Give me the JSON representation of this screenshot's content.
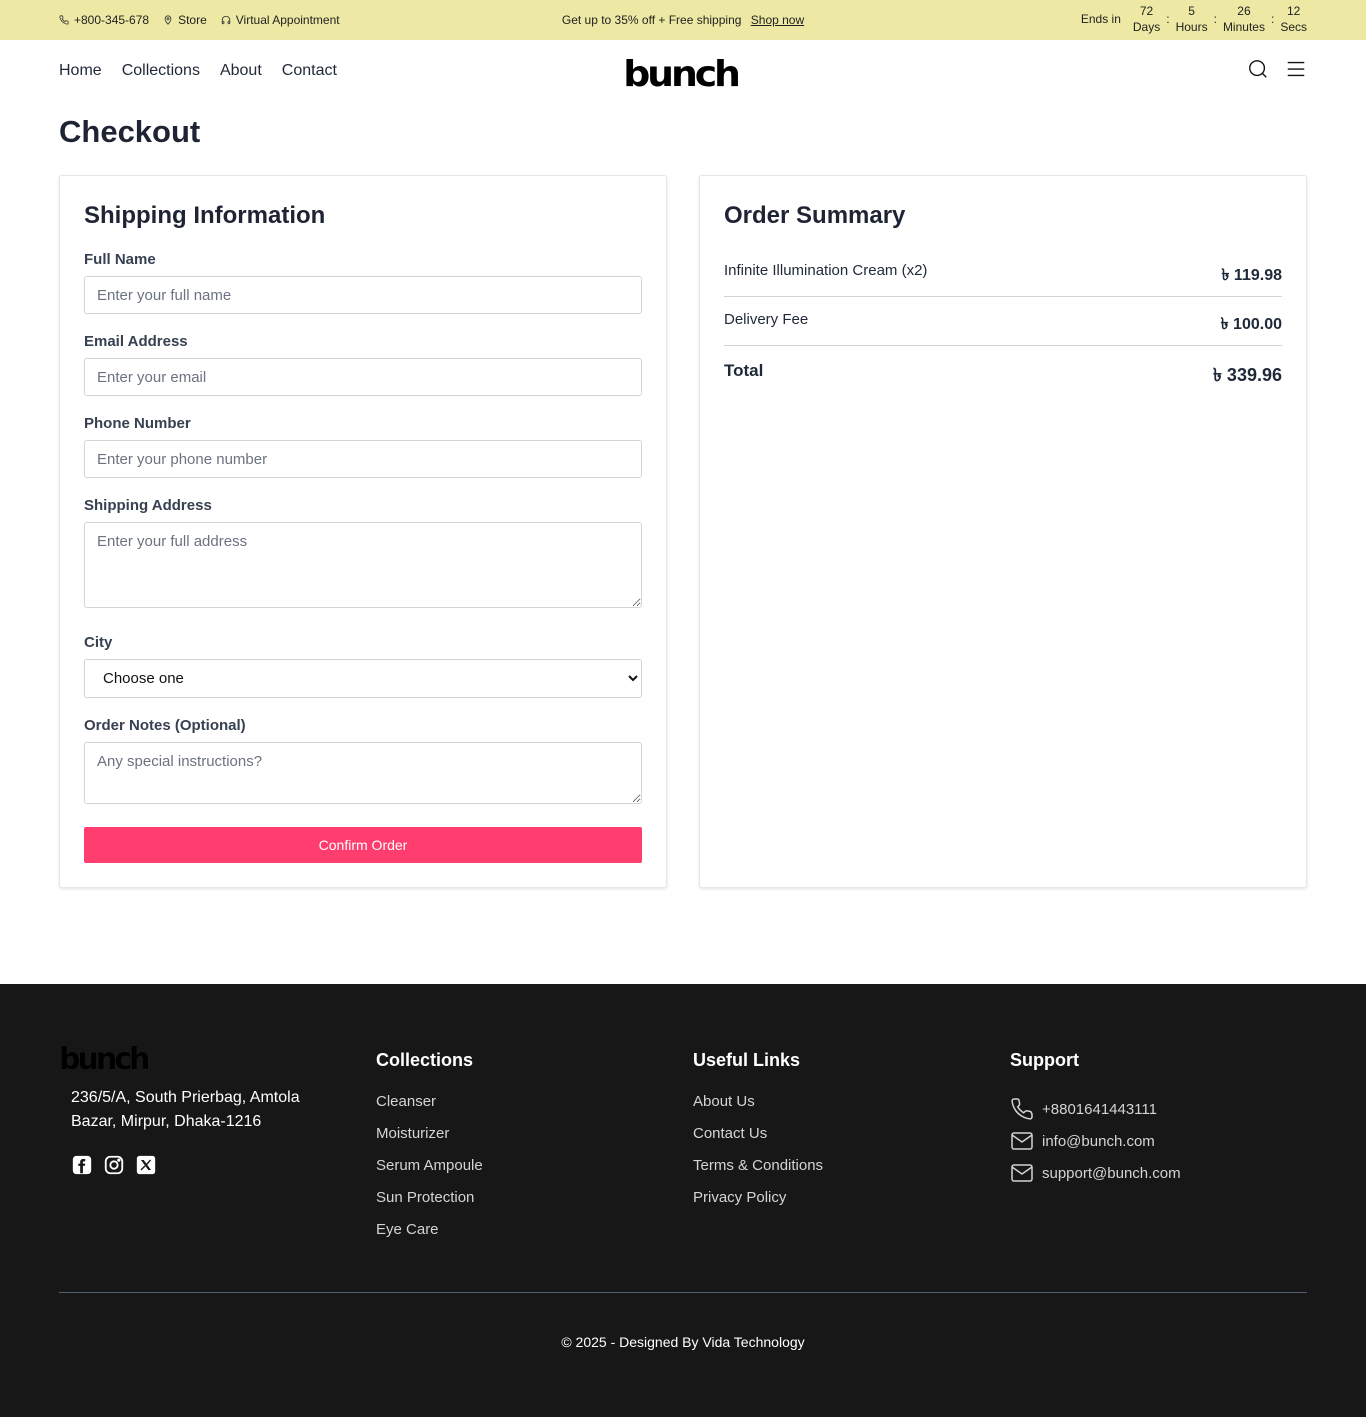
{
  "topbar": {
    "phone": "+800-345-678",
    "store": "Store",
    "appointment": "Virtual Appointment",
    "promo": "Get up to 35% off + Free shipping",
    "shop_now": "Shop now",
    "ends_in": "Ends in",
    "countdown": [
      {
        "value": "72",
        "unit": "Days"
      },
      {
        "value": "5",
        "unit": "Hours"
      },
      {
        "value": "26",
        "unit": "Minutes"
      },
      {
        "value": "12",
        "unit": "Secs"
      }
    ]
  },
  "nav": {
    "items": [
      "Home",
      "Collections",
      "About",
      "Contact"
    ],
    "logo": "bunch"
  },
  "page": {
    "title": "Checkout"
  },
  "shipping": {
    "heading": "Shipping Information",
    "full_name": {
      "label": "Full Name",
      "placeholder": "Enter your full name"
    },
    "email": {
      "label": "Email Address",
      "placeholder": "Enter your email"
    },
    "phone": {
      "label": "Phone Number",
      "placeholder": "Enter your phone number"
    },
    "address": {
      "label": "Shipping Address",
      "placeholder": "Enter your full address"
    },
    "city": {
      "label": "City",
      "selected": "Choose one"
    },
    "notes": {
      "label": "Order Notes (Optional)",
      "placeholder": "Any special instructions?"
    },
    "confirm": "Confirm Order"
  },
  "summary": {
    "heading": "Order Summary",
    "item": {
      "name": "Infinite Illumination Cream (x2)",
      "price": "৳ 119.98"
    },
    "delivery": {
      "name": "Delivery Fee",
      "price": "৳ 100.00"
    },
    "total": {
      "name": "Total",
      "price": "৳ 339.96"
    }
  },
  "footer": {
    "logo": "bunch",
    "address": "236/5/A, South Prierbag, Amtola Bazar, Mirpur, Dhaka-1216",
    "collections": {
      "heading": "Collections",
      "links": [
        "Cleanser",
        "Moisturizer",
        "Serum Ampoule",
        "Sun Protection",
        "Eye Care"
      ]
    },
    "useful": {
      "heading": "Useful Links",
      "links": [
        "About Us",
        "Contact Us",
        "Terms & Conditions",
        "Privacy Policy"
      ]
    },
    "support": {
      "heading": "Support",
      "phone": "+8801641443111",
      "email1": "info@bunch.com",
      "email2": "support@bunch.com"
    },
    "copyright": "© 2025 - Designed By  Vida Technology"
  }
}
